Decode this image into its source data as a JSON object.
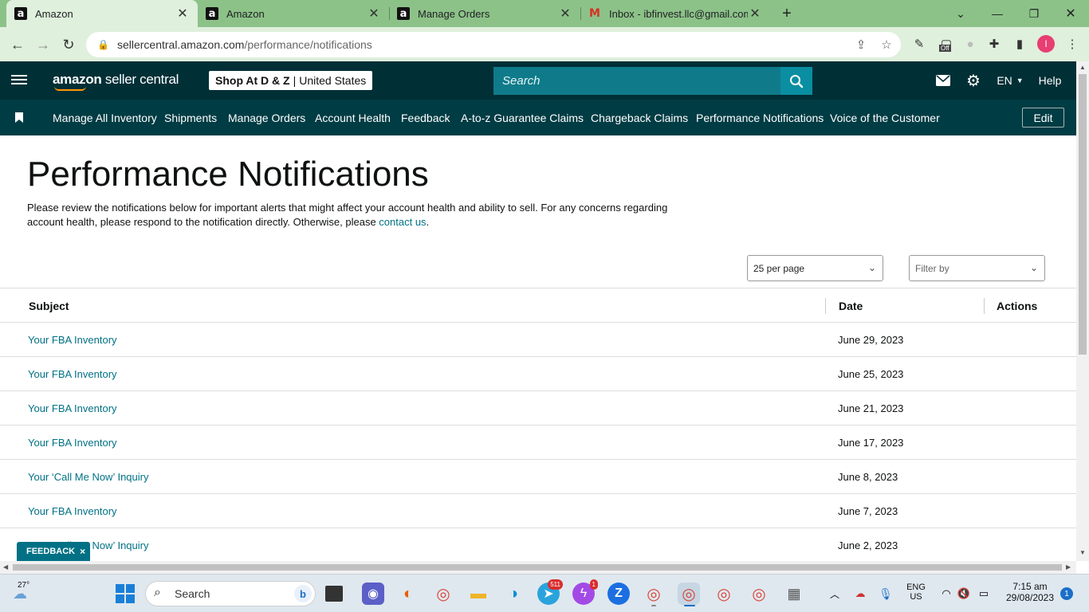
{
  "browser": {
    "tabs": [
      {
        "title": "Amazon",
        "favicon": "amazon-a",
        "active": true
      },
      {
        "title": "Amazon",
        "favicon": "amazon-a",
        "active": false
      },
      {
        "title": "Manage Orders",
        "favicon": "amazon-a",
        "active": false
      },
      {
        "title": "Inbox - ibfinvest.llc@gmail.com -",
        "favicon": "gmail",
        "active": false
      }
    ],
    "url_host": "sellercentral.amazon.com",
    "url_path": "/performance/notifications",
    "extension_off_badge": "Off",
    "profile_initial": "I"
  },
  "header": {
    "logo_bold": "amazon",
    "logo_light": " seller central",
    "store_name": "Shop At D & Z",
    "store_sep": "|",
    "store_region": "United States",
    "search_placeholder": "Search",
    "language": "EN",
    "help": "Help"
  },
  "nav": {
    "items": [
      "Manage All Inventory",
      "Shipments",
      "Manage Orders",
      "Account Health",
      "Feedback",
      "A-to-z Guarantee Claims",
      "Chargeback Claims",
      "Performance Notifications",
      "Voice of the Customer"
    ],
    "edit": "Edit"
  },
  "page": {
    "title": "Performance Notifications",
    "intro": "Please review the notifications below for important alerts that might affect your account health and ability to sell. For any concerns regarding account health, please respond to the notification directly. Otherwise, please ",
    "intro_link": "contact us",
    "intro_end": ".",
    "per_page": "25 per page",
    "filter_placeholder": "Filter by"
  },
  "table": {
    "headers": {
      "subject": "Subject",
      "date": "Date",
      "actions": "Actions"
    },
    "rows": [
      {
        "subject": "Your FBA Inventory",
        "date": "June 29, 2023"
      },
      {
        "subject": "Your FBA Inventory",
        "date": "June 25, 2023"
      },
      {
        "subject": "Your FBA Inventory",
        "date": "June 21, 2023"
      },
      {
        "subject": "Your FBA Inventory",
        "date": "June 17, 2023"
      },
      {
        "subject": "Your ‘Call Me Now’ Inquiry",
        "date": "June 8, 2023"
      },
      {
        "subject": "Your FBA Inventory",
        "date": "June 7, 2023"
      },
      {
        "subject": "Your ‘Call Me Now’ Inquiry",
        "date": "June 2, 2023"
      }
    ]
  },
  "feedback_tab": {
    "label": "FEEDBACK",
    "close": "×"
  },
  "taskbar": {
    "weather_temp": "27°",
    "search_label": "Search",
    "telegram_badge": "511",
    "messenger_badge": "1",
    "lang_line1": "ENG",
    "lang_line2": "US",
    "time": "7:15 am",
    "date": "29/08/2023",
    "notification_count": "1"
  },
  "colors": {
    "header_bg": "#002f36",
    "nav_bg": "#003c44",
    "link": "#007185",
    "tabbar_bg": "#8cc288"
  }
}
